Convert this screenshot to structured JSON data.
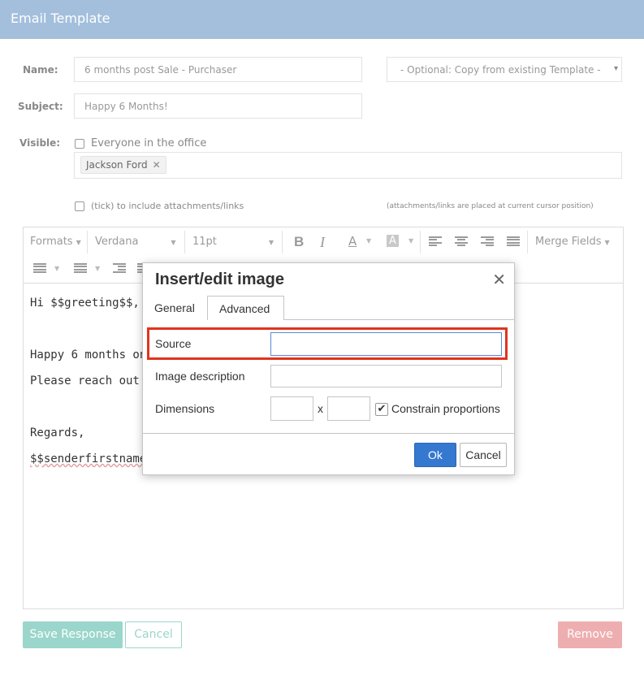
{
  "header": {
    "title": "Email Template"
  },
  "form": {
    "name_label": "Name:",
    "name_value": "6 months post Sale - Purchaser",
    "copy_select": "- Optional: Copy from existing Template -",
    "subject_label": "Subject:",
    "subject_value": "Happy 6 Months!",
    "visible_label": "Visible:",
    "everyone_label": "Everyone in the office",
    "visible_tags": [
      "Jackson Ford"
    ],
    "attachments_label": "(tick) to include attachments/links",
    "attachments_note": "(attachments/links are placed at current cursor position)"
  },
  "toolbar": {
    "formats": "Formats",
    "font": "Verdana",
    "size": "11pt",
    "merge_fields": "Merge Fields"
  },
  "editor_body": {
    "line1": "Hi $$greeting$$,",
    "line2": "Happy 6 months on",
    "line3": "Please reach out sh",
    "line4": "Regards,",
    "line5": "$$senderfirstname$"
  },
  "modal": {
    "title": "Insert/edit image",
    "tabs": [
      "General",
      "Advanced"
    ],
    "source_label": "Source",
    "source_value": "",
    "description_label": "Image description",
    "description_value": "",
    "dimensions_label": "Dimensions",
    "dim_separator": "x",
    "constrain_label": "Constrain proportions",
    "constrain_checked": true,
    "ok_label": "Ok",
    "cancel_label": "Cancel"
  },
  "actions": {
    "save_label": "Save Response",
    "cancel_label": "Cancel",
    "remove_label": "Remove"
  },
  "colors": {
    "header_bg": "#a3bfdc",
    "save_bg": "#9ad6cb",
    "remove_bg": "#eeaeb0",
    "ok_bg": "#3578d0",
    "highlight": "#e0341f"
  }
}
